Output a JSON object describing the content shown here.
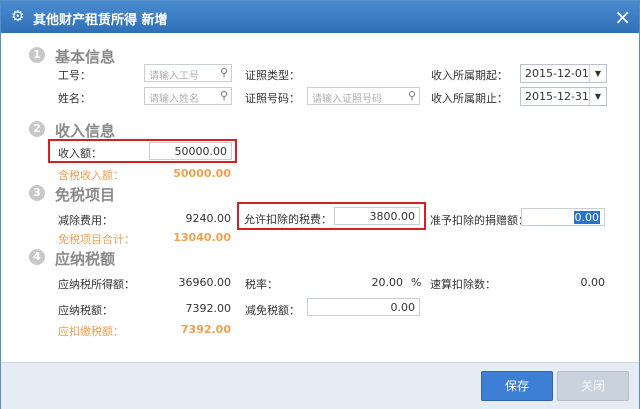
{
  "window": {
    "title": "其他财产租赁所得 新增"
  },
  "sections": {
    "s1": {
      "num": "1",
      "title": "基本信息"
    },
    "s2": {
      "num": "2",
      "title": "收入信息"
    },
    "s3": {
      "num": "3",
      "title": "免税项目"
    },
    "s4": {
      "num": "4",
      "title": "应纳税额"
    }
  },
  "basic": {
    "job_no_label": "工号：",
    "job_no_placeholder": "请输入工号",
    "name_label": "姓名：",
    "name_placeholder": "请输入姓名",
    "id_type_label": "证照类型：",
    "id_no_label": "证照号码：",
    "id_no_placeholder": "请输入证照号码",
    "period_start_label": "收入所属期起：",
    "period_start_value": "2015-12-01",
    "period_end_label": "收入所属期止：",
    "period_end_value": "2015-12-31"
  },
  "income": {
    "amount_label": "收入额：",
    "amount_value": "50000.00",
    "taxable_label": "含税收入额：",
    "taxable_value": "50000.00"
  },
  "exempt": {
    "deduction_label": "减除费用：",
    "deduction_value": "9240.00",
    "tax_label": "允许扣除的税费：",
    "tax_value": "3800.00",
    "donation_label": "准予扣除的捐赠额：",
    "donation_value": "0.00",
    "total_label": "免税项目合计：",
    "total_value": "13040.00"
  },
  "payable": {
    "taxable_income_label": "应纳税所得额：",
    "taxable_income_value": "36960.00",
    "rate_label": "税率：",
    "rate_value": "20.00",
    "rate_unit": "%",
    "quick_deduction_label": "速算扣除数：",
    "quick_deduction_value": "0.00",
    "tax_label": "应纳税额：",
    "tax_value": "7392.00",
    "relief_label": "减免税额：",
    "relief_value": "0.00",
    "withhold_label": "应扣缴税额：",
    "withhold_value": "7392.00"
  },
  "buttons": {
    "save": "保存",
    "close": "关闭"
  }
}
